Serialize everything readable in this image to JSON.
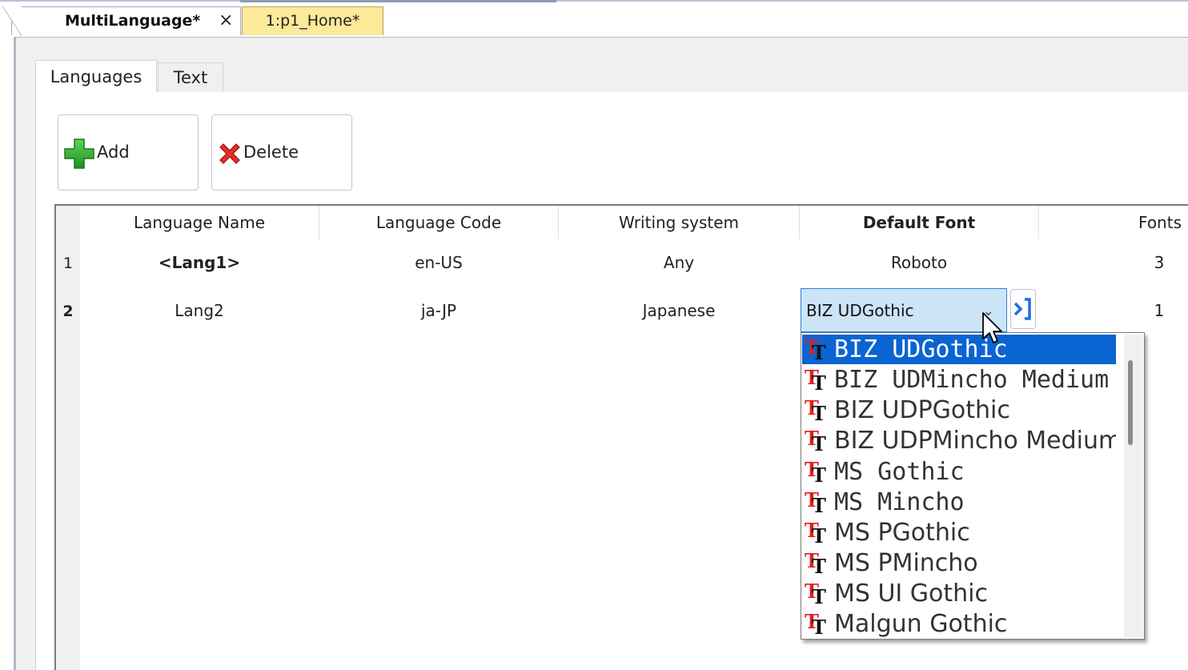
{
  "doc_tabs": [
    {
      "label": "MultiLanguage*",
      "close": "×"
    },
    {
      "label": "1:p1_Home*"
    }
  ],
  "inner_tabs": [
    "Languages",
    "Text"
  ],
  "toolbar": {
    "add_label": "Add",
    "delete_label": "Delete"
  },
  "grid": {
    "headers": [
      "Language Name",
      "Language Code",
      "Writing system",
      "Default Font",
      "Fonts"
    ],
    "rows": [
      {
        "num": "1",
        "name": "<Lang1>",
        "code": "en-US",
        "writing": "Any",
        "font": "Roboto",
        "fonts": "3"
      },
      {
        "num": "2",
        "name": "Lang2",
        "code": "ja-JP",
        "writing": "Japanese",
        "font": "BIZ UDGothic",
        "fonts": "1"
      }
    ]
  },
  "font_dropdown": {
    "selected": "BIZ UDGothic",
    "items": [
      "BIZ UDGothic",
      "BIZ UDMincho Medium",
      "BIZ UDPGothic",
      "BIZ UDPMincho Medium",
      "MS Gothic",
      "MS Mincho",
      "MS PGothic",
      "MS PMincho",
      "MS UI Gothic",
      "Malgun Gothic"
    ],
    "icon": "truetype-font-icon"
  },
  "colors": {
    "accent": "#0a64d2",
    "combo_bg": "#cce4f7",
    "tab_home": "#fce999",
    "tt_red": "#e0201a"
  }
}
